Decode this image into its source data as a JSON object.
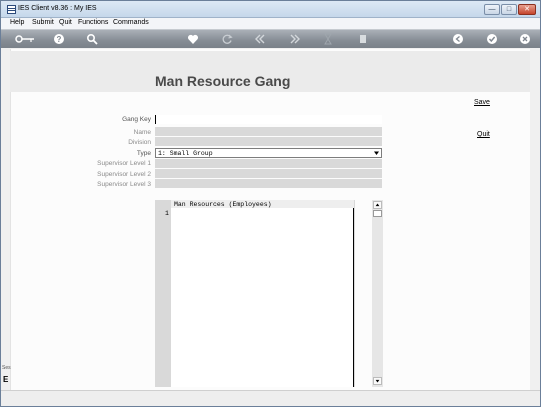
{
  "window": {
    "title": "IES Client v8.36 : My IES",
    "minimize_glyph": "—",
    "maximize_glyph": "□",
    "close_glyph": "✕"
  },
  "menu": {
    "items": [
      "Help",
      "Submit",
      "Quit",
      "Functions",
      "Commands"
    ]
  },
  "toolbar": {
    "icons": [
      "key-icon",
      "help-icon",
      "search-icon",
      "heart-icon",
      "refresh-icon",
      "rewind-icon",
      "fast-forward-icon",
      "hourglass-icon",
      "page-icon",
      "back-circle-icon",
      "check-circle-icon",
      "close-circle-icon"
    ]
  },
  "page": {
    "title": "Man Resource Gang"
  },
  "actions": {
    "save_label": "Save",
    "quit_label": "Quit"
  },
  "form": {
    "gang_key_label": "Gang Key",
    "gang_key_value": "",
    "name_label": "Name",
    "name_value": "",
    "division_label": "Division",
    "division_value": "",
    "type_label": "Type",
    "type_value": "1: Small Group",
    "supervisor1_label": "Supervisor Level 1",
    "supervisor1_value": "",
    "supervisor2_label": "Supervisor Level 2",
    "supervisor2_value": "",
    "supervisor3_label": "Supervisor Level 3",
    "supervisor3_value": ""
  },
  "grid": {
    "header": "Man Resources (Employees)",
    "rows": [
      {
        "num": "1",
        "value": ""
      }
    ]
  },
  "side_stub": {
    "text1": "Ses",
    "text2": "E"
  }
}
